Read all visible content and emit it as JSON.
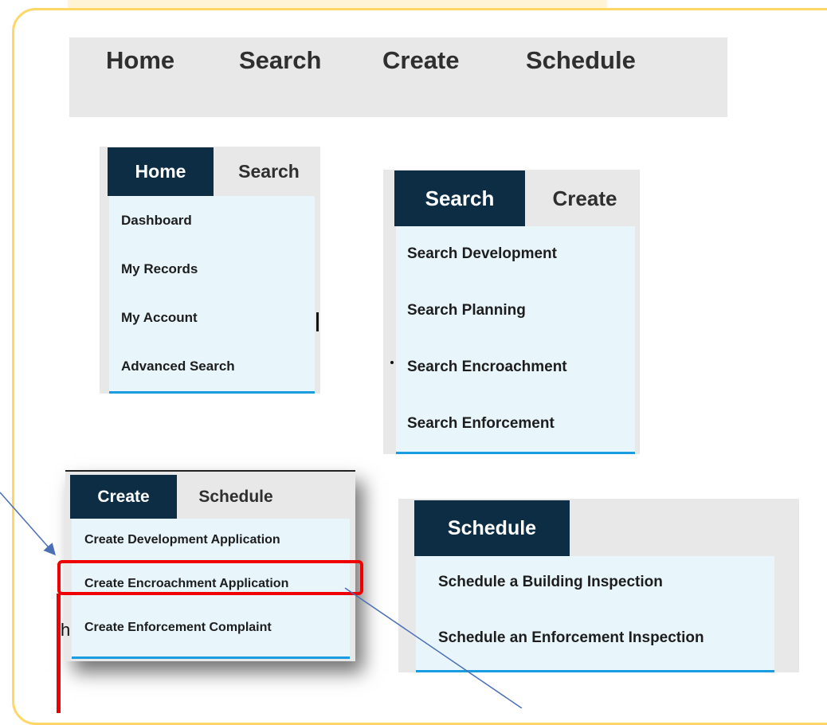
{
  "main_nav": {
    "items": [
      "Home",
      "Search",
      "Create",
      "Schedule"
    ]
  },
  "home_menu": {
    "active_tab": "Home",
    "next_tab": "Search",
    "items": [
      "Dashboard",
      "My Records",
      "My Account",
      "Advanced Search"
    ]
  },
  "search_menu": {
    "active_tab": "Search",
    "next_tab": "Create",
    "items": [
      "Search Development",
      "Search Planning",
      "Search Encroachment",
      "Search Enforcement"
    ]
  },
  "create_menu": {
    "active_tab": "Create",
    "next_tab": "Schedule",
    "items": [
      "Create Development Application",
      "Create Encroachment Application",
      "Create Enforcement Complaint"
    ]
  },
  "schedule_menu": {
    "active_tab": "Schedule",
    "items": [
      "Schedule a Building Inspection",
      "Schedule an Enforcement Inspection"
    ]
  },
  "stray_text": {
    "h_fragment": "h"
  },
  "colors": {
    "frame_border": "#ffd766",
    "active_tab_bg": "#0d2d45",
    "dropdown_bg": "#e8f6fc",
    "dropdown_underline": "#1a9ce0",
    "highlight_red": "#ee0000",
    "annotation_arrow": "#4a6fb5"
  }
}
